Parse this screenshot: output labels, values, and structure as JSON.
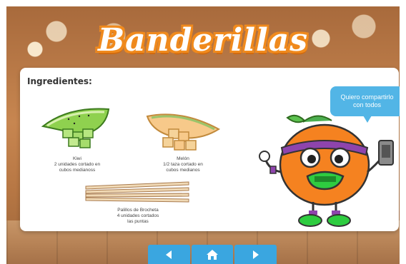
{
  "page": {
    "title": "Banderillas"
  },
  "card": {
    "heading": "Ingredientes:",
    "ingredients": [
      {
        "name": "Kiwi",
        "detail_line1": "2 unidades cortado en",
        "detail_line2": "cubos medianoss",
        "detail_line3": ""
      },
      {
        "name": "Melón",
        "detail_line1": "1/2 taza cortado en",
        "detail_line2": "cubos medianos",
        "detail_line3": ""
      },
      {
        "name": "Palillos de Brocheta",
        "detail_line1": "4 unidades cortados",
        "detail_line2": "las puntas",
        "detail_line3": ""
      }
    ],
    "speech_bubble": "Quiero compartirlo con todos"
  },
  "nav": {
    "prev_icon": "arrow-left-icon",
    "home_icon": "home-icon",
    "next_icon": "arrow-right-icon"
  },
  "colors": {
    "title_outline": "#f08a1d",
    "nav": "#3aa6e0",
    "bubble": "#52b5e6"
  }
}
